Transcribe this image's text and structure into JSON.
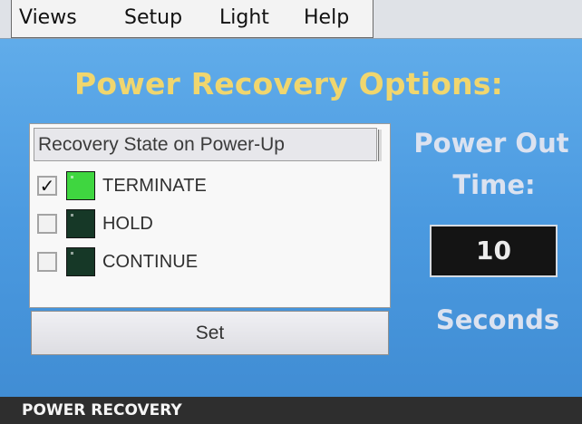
{
  "menu": {
    "items": [
      {
        "label": "Views"
      },
      {
        "label": "Setup"
      },
      {
        "label": "Light"
      },
      {
        "label": "Help"
      }
    ]
  },
  "page": {
    "title": "Power Recovery Options:"
  },
  "recovery_panel": {
    "header": "Recovery State on Power-Up",
    "options": [
      {
        "label": "TERMINATE",
        "checked": true,
        "indicator_color": "#3fd640"
      },
      {
        "label": "HOLD",
        "checked": false,
        "indicator_color": "#163827"
      },
      {
        "label": "CONTINUE",
        "checked": false,
        "indicator_color": "#163827"
      }
    ],
    "checkmark": "✓",
    "set_label": "Set"
  },
  "power_out": {
    "label_line1": "Power Out",
    "label_line2": "Time:",
    "value": "10",
    "units": "Seconds"
  },
  "status": {
    "text": "POWER RECOVERY"
  },
  "colors": {
    "background": "#4f9bd9",
    "title": "#f0d66e",
    "indicator_on": "#3fd640",
    "indicator_off": "#163827",
    "status_bar": "#2e2e2e"
  }
}
